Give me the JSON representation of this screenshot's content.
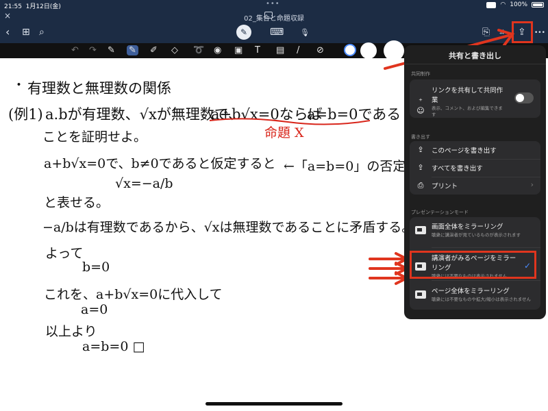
{
  "status": {
    "time": "21:55",
    "date": "1月12日(金)",
    "dots": "•••",
    "battery": "100%"
  },
  "titlebar": {
    "close": "×",
    "doc_title": "02_集合と命題収録"
  },
  "navbar": {
    "back": "‹",
    "grid": "⊞",
    "search": "⌕",
    "pen": "✎",
    "keyboard": "⌨",
    "mic": "🎙",
    "page": "⎘",
    "bookmark": "⌗",
    "share": "⇪",
    "more": "•••"
  },
  "toolbar": {
    "undo": "↶",
    "redo": "↷"
  },
  "note": {
    "bullet": "・",
    "heading": "有理数と無理数の関係",
    "example_label": "(例1)",
    "line1_a": "a.bが有理数、√xが無理数で、",
    "line1_b": "a+b√x=0ならば",
    "line1_c": "a=b=0である",
    "red_note": "命題 X",
    "line2": "ことを証明せよ。",
    "line3": "a+b√x=0で、b≠0であると仮定すると",
    "line3_right": "←「a=b=0」の否定は",
    "line4": "√x=−a/b",
    "line5": "と表せる。",
    "line6": "−a/bは有理数であるから、√xは無理数であることに矛盾する。",
    "line7": "よって",
    "line8": "b=0",
    "line9": "これを、a+b√x=0に代入して",
    "line10": "a=0",
    "line11": "以上より",
    "line12": "a=b=0 □"
  },
  "popover": {
    "title": "共有と書き出し",
    "section_collab": "共同制作",
    "share_link_label": "リンクを共有して共同作業",
    "share_link_sub": "表示、コメント、および編集できます",
    "section_export": "書き出す",
    "export_page": "このページを書き出す",
    "export_all": "すべてを書き出す",
    "print": "プリント",
    "section_present": "プレゼンテーションモード",
    "mirror_screen": "画面全体をミラーリング",
    "mirror_screen_sub": "聴衆に講演者が見ているものが表示されます",
    "mirror_presenter": "講演者がみるページをミラーリング",
    "mirror_presenter_sub": "聴衆には不要なものは表示されません",
    "mirror_page": "ページ全体をミラーリング",
    "mirror_page_sub": "聴衆には不要なものや拡大/縮小は表示されません"
  },
  "colors": {
    "accent_red": "#e0351e",
    "check_blue": "#4b8bff",
    "bar_bg": "#1c2c44"
  }
}
